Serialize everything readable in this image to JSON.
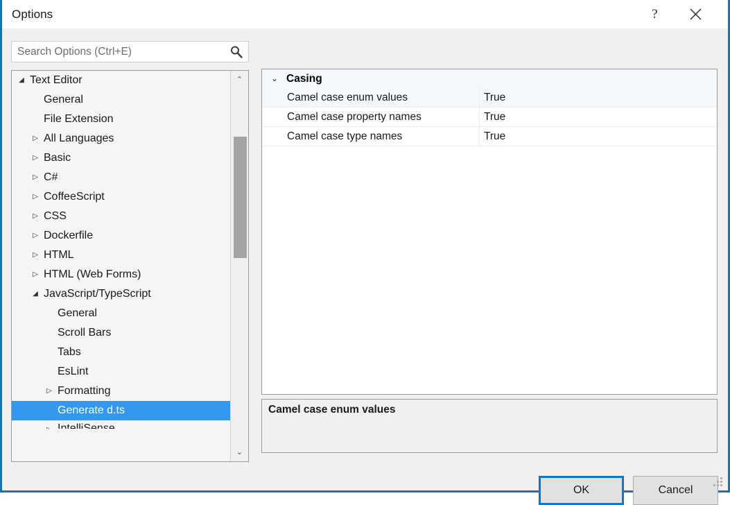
{
  "window": {
    "title": "Options",
    "help_label": "?",
    "close_label": "✕",
    "accent_color": "#1a74a8"
  },
  "search": {
    "placeholder": "Search Options (Ctrl+E)",
    "value": "",
    "icon": "search-icon"
  },
  "tree": {
    "items": [
      {
        "label": "Text Editor",
        "level": 0,
        "expander": "expanded",
        "selected": false
      },
      {
        "label": "General",
        "level": 1,
        "expander": "none",
        "selected": false
      },
      {
        "label": "File Extension",
        "level": 1,
        "expander": "none",
        "selected": false
      },
      {
        "label": "All Languages",
        "level": 1,
        "expander": "collapsed",
        "selected": false
      },
      {
        "label": "Basic",
        "level": 1,
        "expander": "collapsed",
        "selected": false
      },
      {
        "label": "C#",
        "level": 1,
        "expander": "collapsed",
        "selected": false
      },
      {
        "label": "CoffeeScript",
        "level": 1,
        "expander": "collapsed",
        "selected": false
      },
      {
        "label": "CSS",
        "level": 1,
        "expander": "collapsed",
        "selected": false
      },
      {
        "label": "Dockerfile",
        "level": 1,
        "expander": "collapsed",
        "selected": false
      },
      {
        "label": "HTML",
        "level": 1,
        "expander": "collapsed",
        "selected": false
      },
      {
        "label": "HTML (Web Forms)",
        "level": 1,
        "expander": "collapsed",
        "selected": false
      },
      {
        "label": "JavaScript/TypeScript",
        "level": 1,
        "expander": "expanded",
        "selected": false
      },
      {
        "label": "General",
        "level": 2,
        "expander": "none",
        "selected": false
      },
      {
        "label": "Scroll Bars",
        "level": 2,
        "expander": "none",
        "selected": false
      },
      {
        "label": "Tabs",
        "level": 2,
        "expander": "none",
        "selected": false
      },
      {
        "label": "EsLint",
        "level": 2,
        "expander": "none",
        "selected": false
      },
      {
        "label": "Formatting",
        "level": 2,
        "expander": "collapsed",
        "selected": false
      },
      {
        "label": "Generate d.ts",
        "level": 2,
        "expander": "none",
        "selected": true
      },
      {
        "label": "IntelliSense",
        "level": 2,
        "expander": "collapsed",
        "selected": false,
        "clipped": true
      }
    ],
    "scrollbar": {
      "up_arrow": "⌃",
      "down_arrow": "⌄",
      "thumb_color": "#a4a4a4"
    },
    "selection_color": "#3399ee"
  },
  "grid": {
    "category": {
      "label": "Casing",
      "chevron": "⌄",
      "expanded": true
    },
    "rows": [
      {
        "name": "Camel case enum values",
        "value": "True",
        "selected": true
      },
      {
        "name": "Camel case property names",
        "value": "True",
        "selected": false
      },
      {
        "name": "Camel case type names",
        "value": "True",
        "selected": false
      }
    ]
  },
  "description": {
    "title": "Camel case enum values",
    "body": ""
  },
  "footer": {
    "ok_label": "OK",
    "cancel_label": "Cancel",
    "focus_color": "#0078d7"
  }
}
